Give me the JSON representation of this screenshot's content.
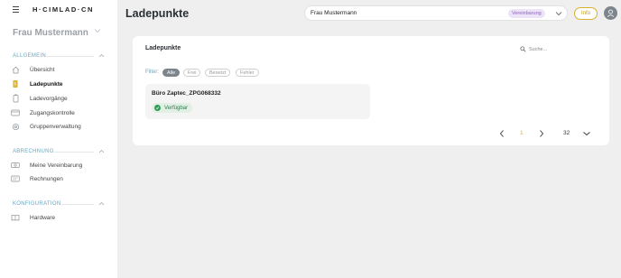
{
  "brand": "H·CIMLAD·CN",
  "sidebar": {
    "account_name": "Frau Mustermann",
    "sections": [
      {
        "title": "ALLGEMEIN",
        "items": [
          {
            "label": "Übersicht",
            "icon": "home-icon"
          },
          {
            "label": "Ladepunkte",
            "icon": "charging-station-icon",
            "active": true
          },
          {
            "label": "Ladevorgänge",
            "icon": "battery-icon"
          },
          {
            "label": "Zugangskontrolle",
            "icon": "card-icon"
          },
          {
            "label": "Gruppenverwaltung",
            "icon": "settings-icon"
          }
        ]
      },
      {
        "title": "ABRECHNUNG",
        "items": [
          {
            "label": "Meine Vereinbarung",
            "icon": "money-icon"
          },
          {
            "label": "Rechnungen",
            "icon": "invoice-icon"
          }
        ]
      },
      {
        "title": "KONFIGURATION",
        "items": [
          {
            "label": "Hardware",
            "icon": "book-icon"
          }
        ]
      }
    ]
  },
  "header": {
    "page_title": "Ladepunkte",
    "user_select": {
      "value": "Frau Mustermann",
      "badge": "Vereinbarung"
    },
    "info_label": "Info"
  },
  "card": {
    "title": "Ladepunkte",
    "search_placeholder": "Suche...",
    "filter_label": "Filter:",
    "filters": [
      "Alle",
      "Frei",
      "Besetzt",
      "Fehler"
    ],
    "active_filter": "Alle",
    "stations": [
      {
        "name": "Büro Zaptec_ZPG068332",
        "status": "Verfügbar"
      }
    ],
    "pagination": {
      "current_page": "1",
      "page_size": "32"
    }
  },
  "colors": {
    "accent": "#d9b12e",
    "section_title": "#6aa7c0",
    "status_available": "#2d9d56",
    "badge_purple": "#8f64c4"
  }
}
